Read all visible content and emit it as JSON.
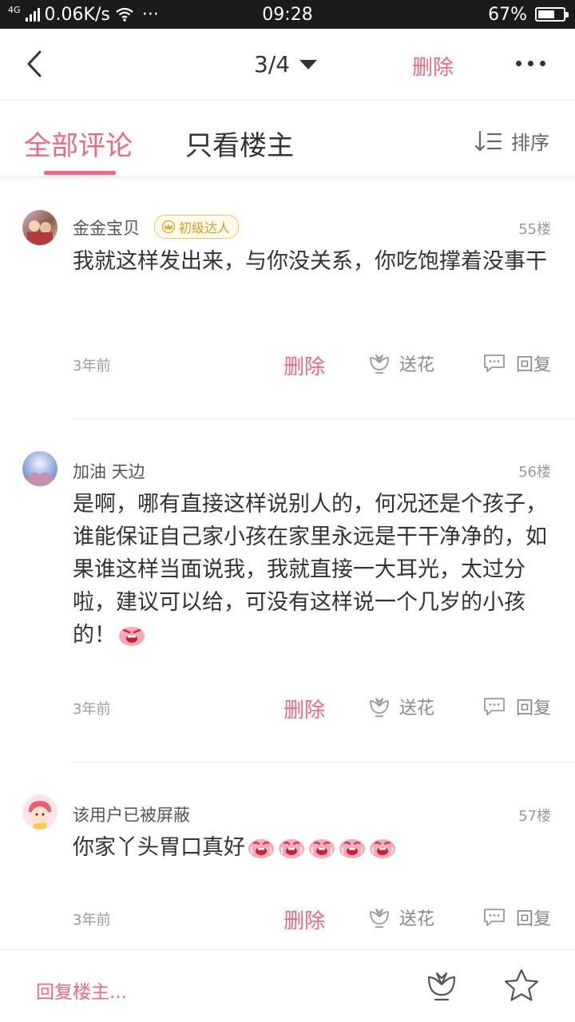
{
  "status_bar": {
    "network_type": "4G",
    "speed": "0.06K/s",
    "more": "···",
    "time": "09:28",
    "battery": "67%",
    "battery_level": 0.67
  },
  "nav": {
    "page_indicator": "3/4",
    "delete_label": "删除",
    "back_icon": "back-chevron-icon",
    "more_icon": "more-dots-icon"
  },
  "tabs": {
    "all": "全部评论",
    "owner_only": "只看楼主",
    "sort_label": "排序",
    "active_color": "#f0677f"
  },
  "comments": [
    {
      "username": "金金宝贝",
      "badge": "初级达人",
      "floor": "55楼",
      "text": "我就这样发出来，与你没关系，你吃饱撑着没事干",
      "time": "3年前",
      "delete": "删除",
      "flower": "送花",
      "reply": "回复"
    },
    {
      "username": "加油  天边",
      "floor": "56楼",
      "text": "是啊，哪有直接这样说别人的，何况还是个孩子，谁能保证自己家小孩在家里永远是干干净净的，如果谁这样当面说我，我就直接一大耳光，太过分啦，建议可以给，可没有这样说一个几岁的小孩的！",
      "time": "3年前",
      "delete": "删除",
      "flower": "送花",
      "reply": "回复"
    },
    {
      "username": "该用户已被屏蔽",
      "floor": "57楼",
      "text": "你家丫头胃口真好",
      "time": "3年前",
      "delete": "删除",
      "flower": "送花",
      "reply": "回复"
    }
  ],
  "bottom_bar": {
    "reply_owner": "回复楼主..."
  }
}
